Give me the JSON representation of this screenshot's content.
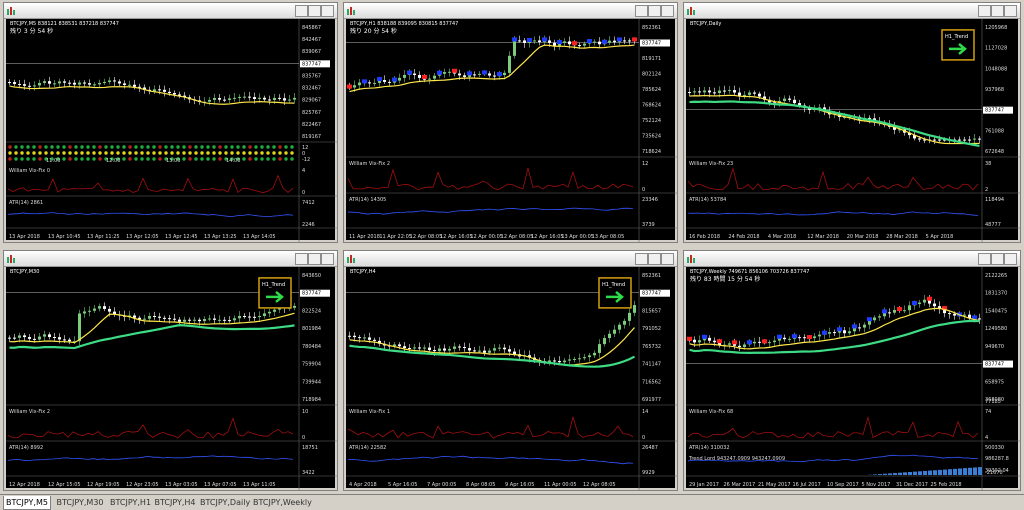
{
  "colors": {
    "chart_bg": "#000000",
    "candle_up": "#7ccd7c",
    "candle_dn": "#ffffff",
    "trend_yellow": "#ffe84a",
    "trend_green": "#3ddc84",
    "vix_red": "#a01010",
    "atr_blue": "#3355ff",
    "buy_marker": "#1e3cff",
    "sell_marker": "#ff2020",
    "badge_border": "#d4a010"
  },
  "windows": [
    {
      "title": "BTCJPY,M5",
      "header": "BTCJPY,M5  838121 838531 837218 837747",
      "countdown": "残り 3 分 54 秒",
      "prices": [
        "845867",
        "842467",
        "839067",
        "837747",
        "835767",
        "832467",
        "829067",
        "825767",
        "822467",
        "819167"
      ],
      "vix_label": "William Vix-Fix 0",
      "vix_scale": [
        "4",
        "0"
      ],
      "atr_label": "ATR(14) 2861",
      "atr_scale": [
        "7412",
        "2246"
      ],
      "dots_scale": [
        "12",
        "0",
        "-12"
      ],
      "time_labels_top": [
        "11:00",
        "12:00",
        "13:00",
        "14:00"
      ],
      "dates": [
        "13 Apr 2018",
        "13 Apr 10:45",
        "13 Apr 11:25",
        "13 Apr 12:05",
        "13 Apr 12:45",
        "13 Apr 13:25",
        "13 Apr 14:05"
      ]
    },
    {
      "title": "BTCJPY,H1",
      "header": "BTCJPY,H1  838188 839095 830815 837747",
      "countdown": "残り 20 分 54 秒",
      "prices": [
        "852361",
        "837747",
        "819171",
        "802124",
        "785624",
        "768624",
        "752124",
        "735624",
        "718624"
      ],
      "vix_label": "William Vix-Fix 2",
      "vix_scale": [
        "12",
        "0"
      ],
      "atr_label": "ATR(14) 14305",
      "atr_scale": [
        "23346",
        "3739"
      ],
      "dates": [
        "11 Apr 2018",
        "11 Apr 22:05",
        "12 Apr 08:05",
        "12 Apr 16:05",
        "12 Apr 00:05",
        "12 Apr 08:05",
        "12 Apr 16:05",
        "13 Apr 00:05",
        "13 Apr 08:05"
      ]
    },
    {
      "title": "BTCJPY,Daily",
      "header": "BTCJPY,Daily",
      "prices": [
        "1205968",
        "1127028",
        "1048088",
        "937968",
        "837747",
        "761088",
        "672648"
      ],
      "badge": "H1_Trend",
      "vix_label": "William Vix-Fix 23",
      "vix_scale": [
        "38",
        "2"
      ],
      "atr_label": "ATR(14) 53784",
      "atr_scale": [
        "118494",
        "48777"
      ],
      "dates": [
        "16 Feb 2018",
        "24 Feb 2018",
        "4 Mar 2018",
        "12 Mar 2018",
        "20 Mar 2018",
        "28 Mar 2018",
        "5 Apr 2018"
      ]
    },
    {
      "title": "BTCJPY,M30",
      "header": "BTCJPY,M30",
      "prices": [
        "843650",
        "837747",
        "822524",
        "801984",
        "780484",
        "759904",
        "739944",
        "718984"
      ],
      "badge": "H1_Trend",
      "vix_label": "William Vix-Fix 2",
      "vix_scale": [
        "10",
        "0"
      ],
      "atr_label": "ATR(14) 8992",
      "atr_scale": [
        "18751",
        "3422"
      ],
      "dates": [
        "12 Apr 2018",
        "12 Apr 15:05",
        "12 Apr 19:05",
        "12 Apr 23:05",
        "13 Apr 03:05",
        "13 Apr 07:05",
        "13 Apr 11:05"
      ]
    },
    {
      "title": "BTCJPY,H4",
      "header": "BTCJPY,H4",
      "prices": [
        "852361",
        "837747",
        "815657",
        "791052",
        "765732",
        "741147",
        "716562",
        "691977"
      ],
      "badge": "H1_Trend",
      "vix_label": "William Vix-Fix 1",
      "vix_scale": [
        "14",
        "0"
      ],
      "atr_label": "ATR(14) 22582",
      "atr_scale": [
        "26487",
        "9929"
      ],
      "dates": [
        "4 Apr 2018",
        "5 Apr 16:05",
        "7 Apr 00:05",
        "8 Apr 08:05",
        "9 Apr 16:05",
        "11 Apr 00:05",
        "12 Apr 08:05"
      ]
    },
    {
      "title": "BTCJPY,Weekly",
      "header": "BTCJPY,Weekly  749671 856106 703726 837747",
      "countdown": "残り 83 時間 15 分 54 秒",
      "prices": [
        "2122265",
        "1831370",
        "1540475",
        "1249580",
        "949670",
        "837747",
        "658975",
        "368080"
      ],
      "vix_label": "William Vix-Fix 68",
      "vix_scale": [
        "74",
        "4"
      ],
      "atr_label": "ATR(14) 310032",
      "atr_scale": [
        "500330",
        "-21670"
      ],
      "trend_label": "Trend Lord 943247.0909 943247.0909",
      "trend_scale": [
        "986287.8",
        "39392.04"
      ],
      "weekly_low": "77185",
      "dates": [
        "29 Jan 2017",
        "26 Mar 2017",
        "21 May 2017",
        "16 Jul 2017",
        "10 Sep 2017",
        "5 Nov 2017",
        "31 Dec 2017",
        "25 Feb 2018"
      ]
    }
  ],
  "tabs": [
    "BTCJPY,M5",
    "BTCJPY,M30",
    "BTCJPY,H1",
    "BTCJPY,H4",
    "BTCJPY,Daily",
    "BTCJPY,Weekly"
  ],
  "window_buttons": {
    "min": "_",
    "max": "□",
    "close": "×"
  }
}
